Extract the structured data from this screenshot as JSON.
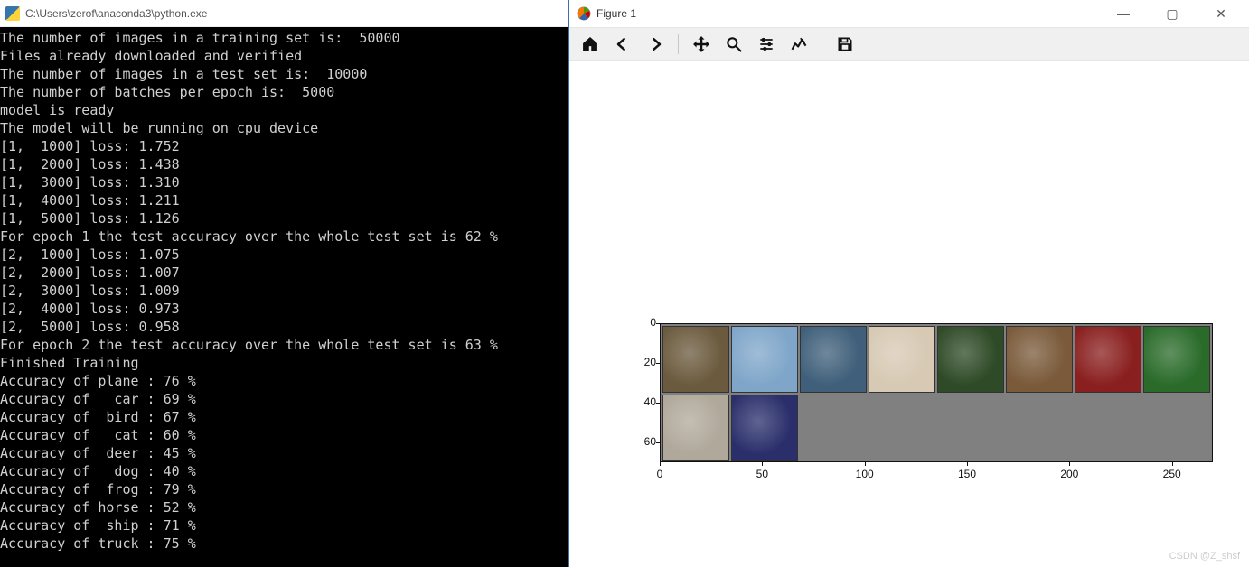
{
  "console": {
    "title": "C:\\Users\\zerof\\anaconda3\\python.exe",
    "lines": [
      "The number of images in a training set is:  50000",
      "Files already downloaded and verified",
      "The number of images in a test set is:  10000",
      "The number of batches per epoch is:  5000",
      "model is ready",
      "The model will be running on cpu device",
      "[1,  1000] loss: 1.752",
      "[1,  2000] loss: 1.438",
      "[1,  3000] loss: 1.310",
      "[1,  4000] loss: 1.211",
      "[1,  5000] loss: 1.126",
      "For epoch 1 the test accuracy over the whole test set is 62 %",
      "[2,  1000] loss: 1.075",
      "[2,  2000] loss: 1.007",
      "[2,  3000] loss: 1.009",
      "[2,  4000] loss: 0.973",
      "[2,  5000] loss: 0.958",
      "For epoch 2 the test accuracy over the whole test set is 63 %",
      "Finished Training",
      "Accuracy of plane : 76 %",
      "Accuracy of   car : 69 %",
      "Accuracy of  bird : 67 %",
      "Accuracy of   cat : 60 %",
      "Accuracy of  deer : 45 %",
      "Accuracy of   dog : 40 %",
      "Accuracy of  frog : 79 %",
      "Accuracy of horse : 52 %",
      "Accuracy of  ship : 71 %",
      "Accuracy of truck : 75 %"
    ]
  },
  "figure": {
    "title": "Figure 1",
    "toolbar": {
      "home": "home-icon",
      "back": "back-icon",
      "forward": "forward-icon",
      "pan": "pan-icon",
      "zoom": "zoom-icon",
      "configure": "configure-icon",
      "edit": "edit-icon",
      "save": "save-icon"
    }
  },
  "chart_data": {
    "type": "image-grid",
    "xlim": [
      0,
      270
    ],
    "ylim": [
      0,
      70
    ],
    "xticks": [
      0,
      50,
      100,
      150,
      200,
      250
    ],
    "yticks": [
      0,
      20,
      40,
      60
    ],
    "thumbs": [
      {
        "row": 0,
        "col": 0,
        "color": "#6b5a3d"
      },
      {
        "row": 0,
        "col": 1,
        "color": "#7fa6c9"
      },
      {
        "row": 0,
        "col": 2,
        "color": "#3f5f7a"
      },
      {
        "row": 0,
        "col": 3,
        "color": "#d7c9b3"
      },
      {
        "row": 0,
        "col": 4,
        "color": "#2e4a26"
      },
      {
        "row": 0,
        "col": 5,
        "color": "#7a5a3a"
      },
      {
        "row": 0,
        "col": 6,
        "color": "#8a1f1f"
      },
      {
        "row": 0,
        "col": 7,
        "color": "#2a6b2a"
      },
      {
        "row": 1,
        "col": 0,
        "color": "#b0a89a"
      },
      {
        "row": 1,
        "col": 1,
        "color": "#2a2f6b"
      }
    ]
  },
  "watermark": "CSDN @Z_shsf"
}
